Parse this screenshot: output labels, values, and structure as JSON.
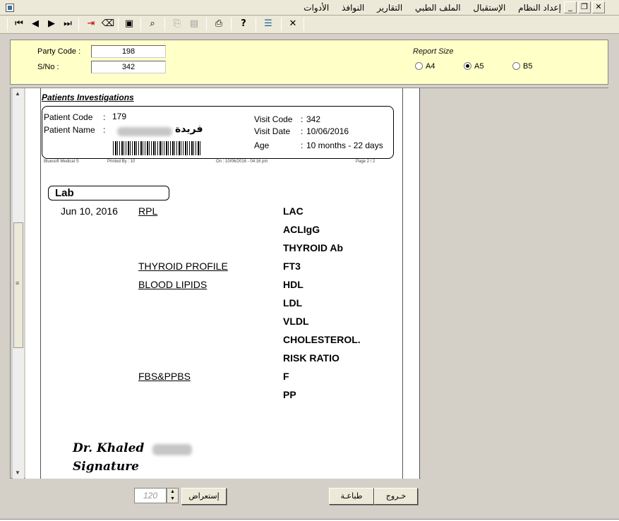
{
  "menu": {
    "items": [
      "إعداد النظام",
      "الإستقبال",
      "الملف الطبي",
      "التقارير",
      "النوافذ",
      "الأدوات"
    ]
  },
  "window_controls": {
    "close": "✕",
    "restore": "❐",
    "minimize": "_"
  },
  "toolbar": {
    "icons": [
      "first-record-icon",
      "previous-record-icon",
      "next-record-icon",
      "last-record-icon",
      "exit-door-icon",
      "eraser-icon",
      "save-disk-icon",
      "search-magnifier-icon",
      "copy-icon",
      "paste-icon",
      "printer-icon",
      "help-question-icon",
      "report-list-icon",
      "close-x-icon"
    ]
  },
  "params": {
    "party_code_label": "Party Code :",
    "party_code_value": "198",
    "sno_label": "S/No :",
    "sno_value": "342",
    "report_size_label": "Report Size",
    "sizes": [
      {
        "label": "A4",
        "selected": false
      },
      {
        "label": "A5",
        "selected": true
      },
      {
        "label": "B5",
        "selected": false
      }
    ]
  },
  "report": {
    "title": "Patients Investigations",
    "patient_code_label": "Patient Code",
    "patient_code_value": "179",
    "patient_name_label": "Patient Name",
    "patient_name_value": "فريدة",
    "visit_code_label": "Visit Code",
    "visit_code_value": "342",
    "visit_date_label": "Visit Date",
    "visit_date_value": "10/06/2016",
    "age_label": "Age",
    "age_value": "10 months - 22 days",
    "footer_company": "Bluesoft Medical S",
    "footer_printed_by": "Printed By :   10",
    "footer_on": "On :  10/06/2016  -  04:16 pm",
    "footer_page": "Page   2  /   2",
    "section": "Lab",
    "date": "Jun 10, 2016",
    "groups": [
      {
        "name": "RPL",
        "tests": [
          "LAC",
          "ACLIgG",
          "THYROID Ab"
        ]
      },
      {
        "name": "THYROID PROFILE",
        "tests": [
          "FT3"
        ]
      },
      {
        "name": "BLOOD LIPIDS",
        "tests": [
          "HDL",
          "LDL",
          "VLDL",
          "CHOLESTEROL.",
          "RISK RATIO"
        ]
      },
      {
        "name": "FBS&PPBS",
        "tests": [
          "F",
          "PP"
        ]
      }
    ],
    "doctor": "Dr. Khaled",
    "signature": "Signature"
  },
  "bottom": {
    "zoom_value": "120",
    "preview_button": "إستعراض",
    "print_button": "طباعـة",
    "exit_button": "خـروج"
  }
}
